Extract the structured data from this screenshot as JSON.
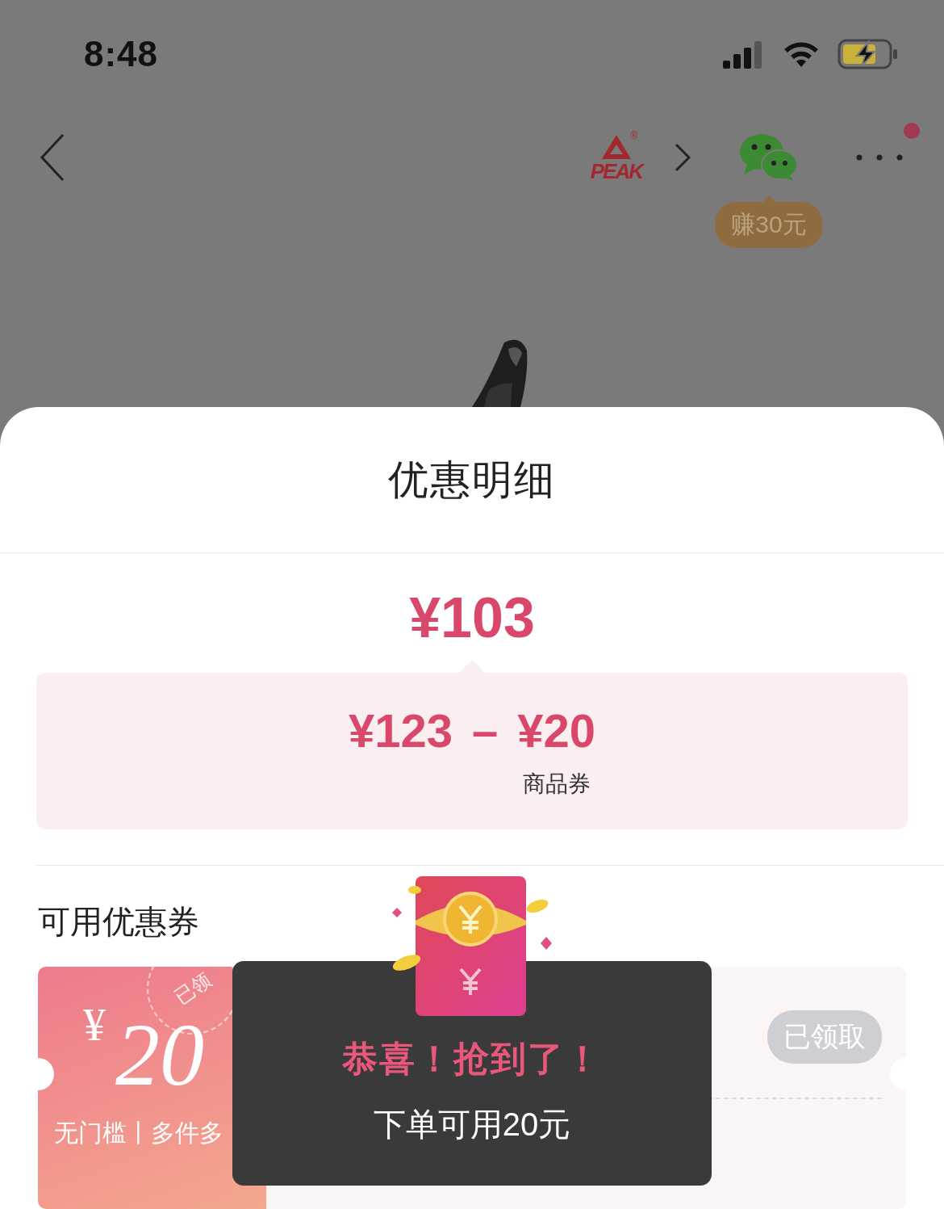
{
  "status_bar": {
    "time": "8:48"
  },
  "nav": {
    "brand": "PEAK",
    "brand_mark": "®",
    "share_badge": "赚30元",
    "notification_dot": true
  },
  "sheet": {
    "title": "优惠明细",
    "final_price": "¥103",
    "breakdown": {
      "original": "¥123",
      "operator": "–",
      "discount": "¥20",
      "discount_label": "商品券"
    },
    "coupons_heading": "可用优惠券",
    "coupons": [
      {
        "symbol": "¥",
        "amount": "20",
        "stamp": "已领",
        "conditions": "无门槛丨多件多",
        "button": "已领取",
        "claimed": true
      }
    ]
  },
  "toast": {
    "title": "恭喜！抢到了！",
    "message": "下单可用20元"
  }
}
